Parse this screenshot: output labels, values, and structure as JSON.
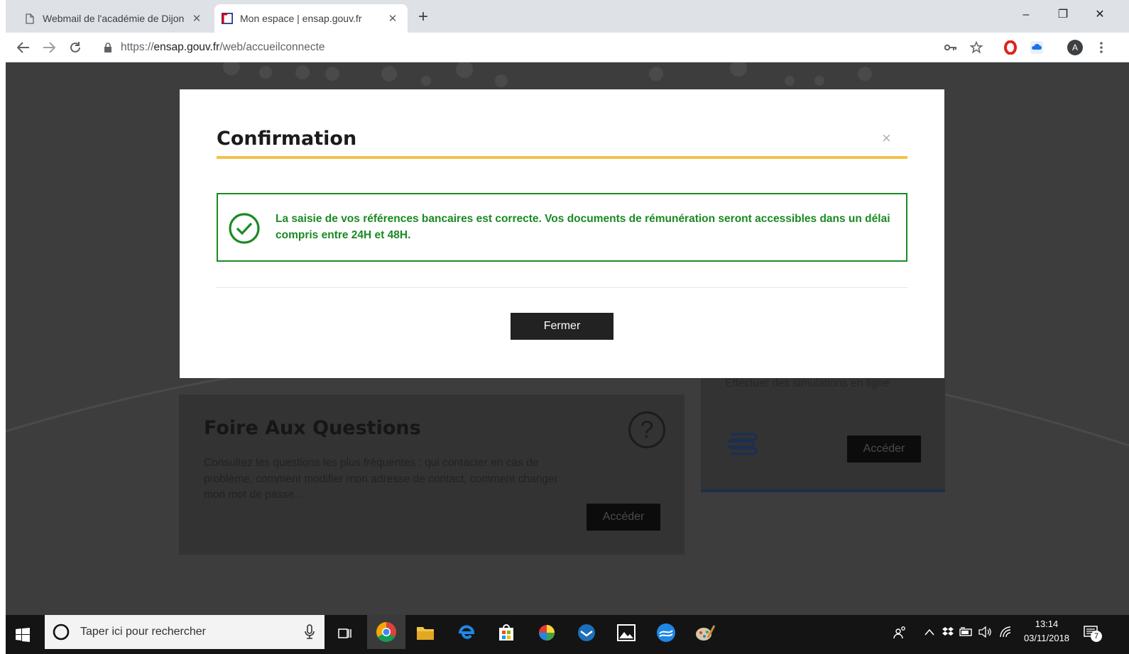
{
  "browser": {
    "tabs": [
      {
        "title": "Webmail de l'académie de Dijon",
        "close": "✕"
      },
      {
        "title": "Mon espace | ensap.gouv.fr",
        "close": "✕"
      }
    ],
    "new_tab": "+",
    "url": {
      "scheme": "https://",
      "host": "ensap.gouv.fr",
      "path": "/web/accueilconnecte"
    },
    "profile_initial": "A",
    "window_controls": {
      "minimize": "–",
      "maximize": "❐",
      "close": "✕"
    }
  },
  "page": {
    "faq": {
      "title": "Foire Aux Questions",
      "text": "Consultez les questions les plus fréquentes :  qui contacter en cas de problème, comment modifier mon adresse de contact, comment changer mon mot de passe...",
      "button": "Accéder",
      "icon": "?"
    },
    "simulation": {
      "text": "Effectuer des simulations en ligne",
      "button": "Accéder"
    }
  },
  "modal": {
    "title": "Confirmation",
    "close": "×",
    "message": "La saisie de vos références bancaires est correcte. Vos documents de rémunération seront accessibles dans un délai compris entre 24H et 48H.",
    "button": "Fermer",
    "colors": {
      "accent_rule": "#f5c04a",
      "success": "#1a8a22"
    }
  },
  "taskbar": {
    "search_placeholder": "Taper ici pour rechercher",
    "time": "13:14",
    "date": "03/11/2018",
    "notifications_count": "7"
  }
}
